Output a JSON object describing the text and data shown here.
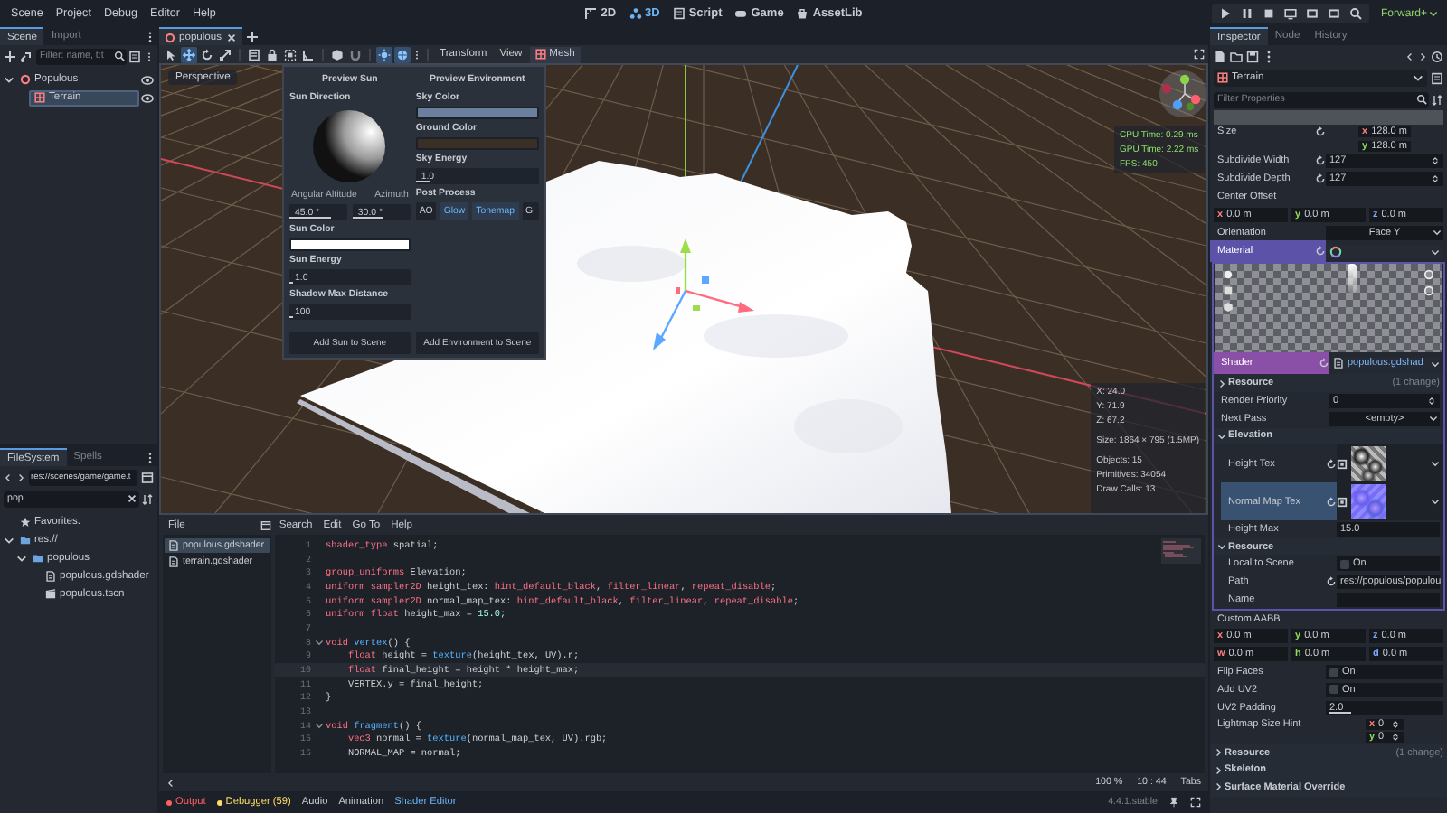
{
  "menu_bar": {
    "menus": [
      "Scene",
      "Project",
      "Debug",
      "Editor",
      "Help"
    ],
    "workspaces": [
      {
        "kind": "flat",
        "label": "2D",
        "selected": false
      },
      {
        "kind": "spatial",
        "label": "3D",
        "selected": true
      },
      {
        "kind": "script",
        "label": "Script",
        "selected": false
      },
      {
        "kind": "game",
        "label": "Game",
        "selected": false
      },
      {
        "kind": "assetlib",
        "label": "AssetLib",
        "selected": false
      }
    ],
    "renderer": "Forward+"
  },
  "scene_dock": {
    "tabs": [
      {
        "label": "Scene",
        "selected": true
      },
      {
        "label": "Import",
        "selected": false
      }
    ],
    "filter": {
      "placeholder": "Filter: name, t:t"
    },
    "tree": [
      {
        "kind": "node3d",
        "label": "Populous",
        "selected": false,
        "expanded": true,
        "children": [
          {
            "kind": "mesh",
            "label": "Terrain",
            "selected": true
          }
        ]
      }
    ]
  },
  "filesystem_dock": {
    "tabs": [
      {
        "label": "FileSystem",
        "selected": true
      },
      {
        "label": "Spells",
        "selected": false
      }
    ],
    "path": "res://scenes/game/game.t",
    "search": "pop",
    "tree": [
      {
        "kind": "favorites",
        "label": "Favorites:"
      },
      {
        "kind": "folder",
        "label": "res://",
        "expanded": true,
        "children": [
          {
            "kind": "folder",
            "label": "populous",
            "expanded": true,
            "children": [
              {
                "kind": "shader",
                "label": "populous.gdshader"
              },
              {
                "kind": "scene",
                "label": "populous.tscn"
              }
            ]
          }
        ]
      }
    ]
  },
  "scene_tabs": [
    {
      "label": "populous",
      "selected": true
    }
  ],
  "viewport_toolbar": {
    "tools": [
      {
        "kind": "select",
        "active": false
      },
      {
        "kind": "move",
        "active": true
      },
      {
        "kind": "rotate",
        "active": false
      },
      {
        "kind": "scale",
        "active": false
      },
      {
        "kind": "list",
        "active": false
      },
      {
        "kind": "lock",
        "active": false
      },
      {
        "kind": "group",
        "active": false
      },
      {
        "kind": "ruler",
        "active": false
      },
      {
        "kind": "cube",
        "active": false
      },
      {
        "kind": "snap",
        "active": false
      },
      {
        "kind": "sun",
        "active": true
      },
      {
        "kind": "environment",
        "active": true
      }
    ],
    "menus": [
      {
        "kind": "plain",
        "label": "Transform"
      },
      {
        "kind": "plain",
        "label": "View"
      },
      {
        "kind": "mesh",
        "label": "Mesh"
      }
    ]
  },
  "viewport": {
    "camera": "Perspective",
    "stats": [
      "CPU Time: 0.29 ms",
      "GPU Time: 2.22 ms",
      "FPS: 450"
    ],
    "info": [
      [
        "X: 24.0",
        "Y: 71.9",
        "Z: 67.2"
      ],
      [
        "Size: 1864 × 795 (1.5MP)"
      ],
      [
        "Objects: 15",
        "Primitives: 34054",
        "Draw Calls: 13"
      ]
    ]
  },
  "preview_popup": {
    "sun": {
      "title": "Preview Sun",
      "direction_label": "Sun Direction",
      "altitude": {
        "label": "Angular Altitude",
        "value": "45.0 °",
        "level": 0.72
      },
      "azimuth": {
        "label": "Azimuth",
        "value": "30.0 °",
        "level": 0.55
      },
      "color": {
        "label": "Sun Color",
        "color": "#ffffff"
      },
      "energy": {
        "label": "Sun Energy",
        "value": "1.0",
        "level": 0.03
      },
      "shadow": {
        "label": "Shadow Max Distance",
        "value": "100",
        "level": 0.03
      },
      "button": "Add Sun to Scene"
    },
    "environment": {
      "title": "Preview Environment",
      "sky_color": {
        "label": "Sky Color",
        "color": "#6b7f9e"
      },
      "ground_color": {
        "label": "Ground Color",
        "color": "#3a2f25"
      },
      "sky_energy": {
        "label": "Sky Energy",
        "value": "1.0",
        "level": 0.12
      },
      "post_process": {
        "label": "Post Process",
        "toggles": [
          {
            "label": "AO",
            "on": false
          },
          {
            "label": "Glow",
            "on": true
          },
          {
            "label": "Tonemap",
            "on": true
          },
          {
            "label": "GI",
            "on": false
          }
        ]
      },
      "button": "Add Environment to Scene"
    }
  },
  "shader_editor": {
    "file_menu": "File",
    "menus": [
      "Search",
      "Edit",
      "Go To",
      "Help"
    ],
    "files": [
      {
        "label": "populous.gdshader",
        "selected": true
      },
      {
        "label": "terrain.gdshader",
        "selected": false
      }
    ],
    "lines": [
      {
        "number": "1",
        "foldable": false,
        "current": false,
        "tokens": [
          {
            "kind": "keyword",
            "text": "shader_type"
          },
          {
            "kind": "plain",
            "text": " spatial;"
          }
        ]
      },
      {
        "number": "2",
        "foldable": false,
        "current": false
      },
      {
        "number": "3",
        "foldable": false,
        "current": false,
        "tokens": [
          {
            "kind": "keyword",
            "text": "group_uniforms"
          },
          {
            "kind": "plain",
            "text": " Elevation;"
          }
        ]
      },
      {
        "number": "4",
        "foldable": false,
        "current": false,
        "tokens": [
          {
            "kind": "keyword",
            "text": "uniform "
          },
          {
            "kind": "keyword",
            "text": "sampler2D"
          },
          {
            "kind": "plain",
            "text": " height_tex: "
          },
          {
            "kind": "keyword",
            "text": "hint_default_black"
          },
          {
            "kind": "plain",
            "text": ", "
          },
          {
            "kind": "keyword",
            "text": "filter_linear"
          },
          {
            "kind": "plain",
            "text": ", "
          },
          {
            "kind": "keyword",
            "text": "repeat_disable"
          },
          {
            "kind": "plain",
            "text": ";"
          }
        ]
      },
      {
        "number": "5",
        "foldable": false,
        "current": false,
        "tokens": [
          {
            "kind": "keyword",
            "text": "uniform "
          },
          {
            "kind": "keyword",
            "text": "sampler2D"
          },
          {
            "kind": "plain",
            "text": " normal_map_tex: "
          },
          {
            "kind": "keyword",
            "text": "hint_default_black"
          },
          {
            "kind": "plain",
            "text": ", "
          },
          {
            "kind": "keyword",
            "text": "filter_linear"
          },
          {
            "kind": "plain",
            "text": ", "
          },
          {
            "kind": "keyword",
            "text": "repeat_disable"
          },
          {
            "kind": "plain",
            "text": ";"
          }
        ]
      },
      {
        "number": "6",
        "foldable": false,
        "current": false,
        "tokens": [
          {
            "kind": "keyword",
            "text": "uniform "
          },
          {
            "kind": "keyword",
            "text": "float"
          },
          {
            "kind": "plain",
            "text": " height_max = "
          },
          {
            "kind": "number",
            "text": "15.0"
          },
          {
            "kind": "plain",
            "text": ";"
          }
        ]
      },
      {
        "number": "7",
        "foldable": false,
        "current": false
      },
      {
        "number": "8",
        "foldable": true,
        "current": false,
        "tokens": [
          {
            "kind": "keyword",
            "text": "void "
          },
          {
            "kind": "function",
            "text": "vertex"
          },
          {
            "kind": "plain",
            "text": "() {"
          }
        ]
      },
      {
        "number": "9",
        "foldable": false,
        "current": false,
        "tokens": [
          {
            "kind": "keyword",
            "text": "\tfloat"
          },
          {
            "kind": "plain",
            "text": " height = "
          },
          {
            "kind": "function",
            "text": "texture"
          },
          {
            "kind": "plain",
            "text": "(height_tex, UV).r;"
          }
        ]
      },
      {
        "number": "10",
        "foldable": false,
        "current": true,
        "tokens": [
          {
            "kind": "keyword",
            "text": "\tfloat"
          },
          {
            "kind": "plain",
            "text": " final_height = height * height_max;"
          }
        ]
      },
      {
        "number": "11",
        "foldable": false,
        "current": false,
        "tokens": [
          {
            "kind": "plain",
            "text": "\tVERTEX.y = final_height;"
          }
        ]
      },
      {
        "number": "12",
        "foldable": false,
        "current": false,
        "tokens": [
          {
            "kind": "plain",
            "text": "}"
          }
        ]
      },
      {
        "number": "13",
        "foldable": false,
        "current": false
      },
      {
        "number": "14",
        "foldable": true,
        "current": false,
        "tokens": [
          {
            "kind": "keyword",
            "text": "void "
          },
          {
            "kind": "function",
            "text": "fragment"
          },
          {
            "kind": "plain",
            "text": "() {"
          }
        ]
      },
      {
        "number": "15",
        "foldable": false,
        "current": false,
        "tokens": [
          {
            "kind": "keyword",
            "text": "\tvec3"
          },
          {
            "kind": "plain",
            "text": " normal = "
          },
          {
            "kind": "function",
            "text": "texture"
          },
          {
            "kind": "plain",
            "text": "(normal_map_tex, UV).rgb;"
          }
        ]
      },
      {
        "number": "16",
        "foldable": false,
        "current": false,
        "tokens": [
          {
            "kind": "plain",
            "text": "\tNORMAL_MAP = normal;"
          }
        ]
      }
    ],
    "status": {
      "zoom": "100 %",
      "position": "10 : 44",
      "indent": "Tabs"
    }
  },
  "bottom_panel": {
    "tabs": [
      {
        "label": "Output",
        "selected": false,
        "color": "#ff5f5f"
      },
      {
        "label": "Debugger (59)",
        "selected": false,
        "color": "#ffdd65"
      },
      {
        "label": "Audio",
        "selected": false
      },
      {
        "label": "Animation",
        "selected": false
      },
      {
        "label": "Shader Editor",
        "selected": true
      }
    ],
    "version": "4.4.1.stable"
  },
  "inspector": {
    "tabs": [
      {
        "label": "Inspector",
        "selected": true
      },
      {
        "label": "Node",
        "selected": false
      },
      {
        "label": "History",
        "selected": false
      }
    ],
    "object": "Terrain",
    "filter": {
      "placeholder": "Filter Properties"
    },
    "rows": [
      {
        "kind": "bar"
      },
      {
        "kind": "stack",
        "label": "Size",
        "revertable": true,
        "components": [
          {
            "axis": "x",
            "value": "128.0 m"
          },
          {
            "axis": "y",
            "value": "128.0 m"
          }
        ]
      },
      {
        "kind": "spin",
        "label": "Subdivide Width",
        "revertable": true,
        "value": "127"
      },
      {
        "kind": "spin",
        "label": "Subdivide Depth",
        "revertable": true,
        "value": "127"
      },
      {
        "kind": "label",
        "label": "Center Offset"
      },
      {
        "kind": "vector",
        "components": [
          {
            "axis": "x",
            "value": "0.0 m"
          },
          {
            "axis": "y",
            "value": "0.0 m"
          },
          {
            "axis": "z",
            "value": "0.0 m"
          }
        ]
      },
      {
        "kind": "dropdown",
        "label": "Orientation",
        "revertable": false,
        "value": "Face Y"
      },
      {
        "kind": "resource",
        "label": "Material",
        "revertable": true,
        "color": "#5c53a8",
        "children": [
          {
            "kind": "preview"
          },
          {
            "kind": "resource",
            "label": "Shader",
            "revertable": true,
            "color": "#8a4fa6",
            "value": "populous.gdshad"
          },
          {
            "kind": "section",
            "label": "Resource",
            "note": "(1 change)",
            "expanded": false
          },
          {
            "kind": "spin",
            "label": "Render Priority",
            "revertable": false,
            "value": "0"
          },
          {
            "kind": "dropdown",
            "label": "Next Pass",
            "revertable": false,
            "value": "<empty>"
          },
          {
            "kind": "section",
            "label": "Elevation",
            "expanded": true,
            "children": [
              {
                "kind": "heightmap",
                "label": "Height Tex",
                "highlighted": false
              },
              {
                "kind": "normalmap",
                "label": "Normal Map Tex",
                "highlighted": true
              },
              {
                "kind": "field",
                "label": "Height Max",
                "revertable": false,
                "value": "15.0"
              }
            ]
          },
          {
            "kind": "section",
            "label": "Resource",
            "expanded": true,
            "children": [
              {
                "kind": "check",
                "label": "Local to Scene",
                "revertable": false,
                "value": "On",
                "checked": false
              },
              {
                "kind": "field",
                "label": "Path",
                "revertable": true,
                "value": "res://populous/populou"
              },
              {
                "kind": "field",
                "label": "Name",
                "revertable": false
              }
            ]
          }
        ]
      },
      {
        "kind": "label",
        "label": "Custom AABB"
      },
      {
        "kind": "vector",
        "components": [
          {
            "axis": "x",
            "value": "0.0 m"
          },
          {
            "axis": "y",
            "value": "0.0 m"
          },
          {
            "axis": "z",
            "value": "0.0 m"
          }
        ]
      },
      {
        "kind": "vector",
        "components": [
          {
            "axis": "w",
            "value": "0.0 m"
          },
          {
            "axis": "h",
            "value": "0.0 m"
          },
          {
            "axis": "d",
            "value": "0.0 m"
          }
        ]
      },
      {
        "kind": "check",
        "label": "Flip Faces",
        "revertable": false,
        "value": "On",
        "checked": false
      },
      {
        "kind": "check",
        "label": "Add UV2",
        "revertable": false,
        "value": "On",
        "checked": false
      },
      {
        "kind": "slider",
        "label": "UV2 Padding",
        "revertable": false,
        "value": "2.0",
        "level": 0.2
      },
      {
        "kind": "spinstack",
        "label": "Lightmap Size Hint",
        "revertable": false,
        "components": [
          {
            "axis": "x",
            "value": "0"
          },
          {
            "axis": "y",
            "value": "0"
          }
        ]
      },
      {
        "kind": "section",
        "label": "Resource",
        "note": "(1 change)",
        "expanded": false
      },
      {
        "kind": "section",
        "label": "Skeleton",
        "expanded": false
      },
      {
        "kind": "section",
        "label": "Surface Material Override",
        "expanded": false
      }
    ]
  }
}
